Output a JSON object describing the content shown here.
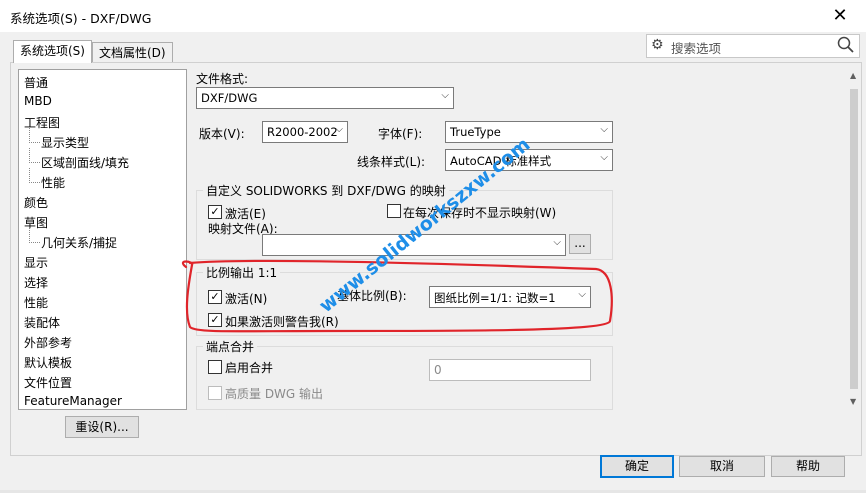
{
  "window": {
    "title": "系统选项(S) - DXF/DWG"
  },
  "tabs": [
    {
      "label": "系统选项(S)",
      "active": true
    },
    {
      "label": "文档属性(D)",
      "active": false
    }
  ],
  "search": {
    "placeholder": "搜索选项"
  },
  "tree": {
    "items": [
      {
        "label": "普通",
        "indent": 0
      },
      {
        "label": "MBD",
        "indent": 0
      },
      {
        "label": "工程图",
        "indent": 0
      },
      {
        "label": "显示类型",
        "indent": 1
      },
      {
        "label": "区域剖面线/填充",
        "indent": 1
      },
      {
        "label": "性能",
        "indent": 1
      },
      {
        "label": "颜色",
        "indent": 0
      },
      {
        "label": "草图",
        "indent": 0
      },
      {
        "label": "几何关系/捕捉",
        "indent": 1
      },
      {
        "label": "显示",
        "indent": 0
      },
      {
        "label": "选择",
        "indent": 0
      },
      {
        "label": "性能",
        "indent": 0
      },
      {
        "label": "装配体",
        "indent": 0
      },
      {
        "label": "外部参考",
        "indent": 0
      },
      {
        "label": "默认模板",
        "indent": 0
      },
      {
        "label": "文件位置",
        "indent": 0
      },
      {
        "label": "FeatureManager",
        "indent": 0
      }
    ]
  },
  "reset_button": "重设(R)...",
  "format": {
    "label": "文件格式:",
    "value": "DXF/DWG"
  },
  "version": {
    "label": "版本(V):",
    "value": "R2000-2002"
  },
  "font": {
    "label": "字体(F):",
    "value": "TrueType"
  },
  "linestyle": {
    "label": "线条样式(L):",
    "value": "AutoCAD 标准样式"
  },
  "mapping": {
    "title": "自定义 SOLIDWORKS 到 DXF/DWG 的映射",
    "activate_label": "激活(E)",
    "activate_checked": true,
    "noshow_label": "在每次保存时不显示映射(W)",
    "noshow_checked": false,
    "file_label": "映射文件(A):",
    "file_value": "",
    "browse_label": "..."
  },
  "scale": {
    "title": "比例输出 1:1",
    "activate_label": "激活(N)",
    "activate_checked": true,
    "base_label": "基体比例(B):",
    "base_value": "图纸比例=1/1: 记数=1",
    "warn_label": "如果激活则警告我(R)",
    "warn_checked": true
  },
  "endpoint": {
    "title": "端点合并",
    "enable_label": "启用合并",
    "enable_checked": false,
    "value": "0",
    "hq_label": "高质量 DWG 输出",
    "hq_checked": false
  },
  "buttons": {
    "ok": "确定",
    "cancel": "取消",
    "help": "帮助"
  },
  "watermark": "www.solidworkszxw.com",
  "colors": {
    "accent": "#0078d7",
    "annotation": "#e0242a",
    "watermark": "#1e8ee8"
  }
}
